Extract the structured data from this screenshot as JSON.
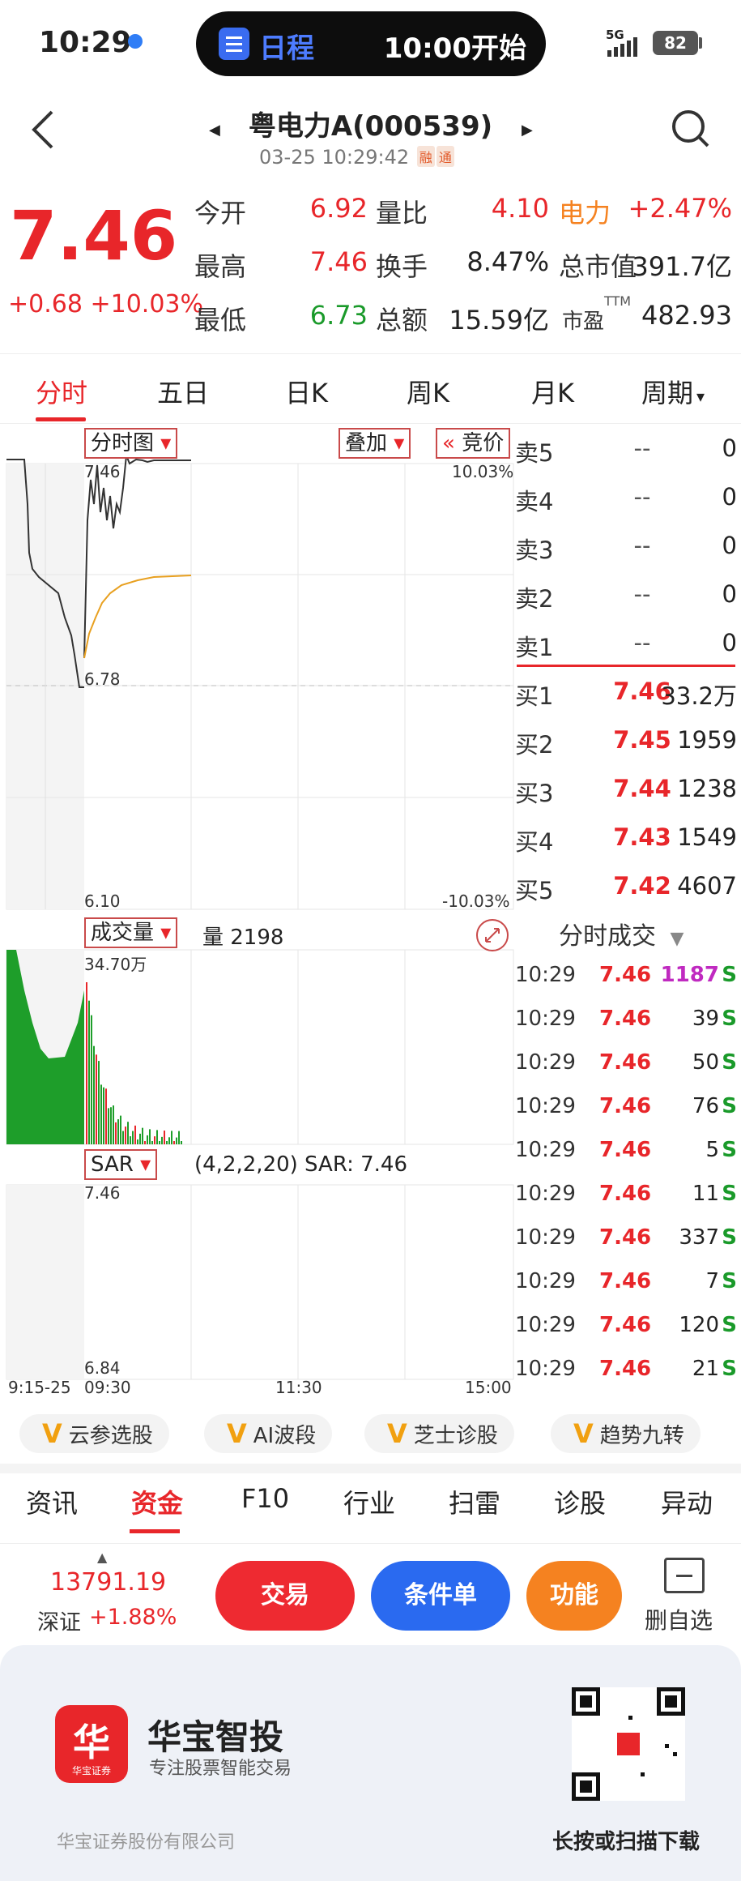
{
  "status_bar": {
    "time": "10:29",
    "schedule_label": "日程",
    "schedule_time": "10:00开始",
    "network": "5G",
    "battery": "82"
  },
  "header": {
    "title": "粤电力A(000539)",
    "datetime": "03-25 10:29:42",
    "tag_rong": "融",
    "tag_tong": "通"
  },
  "quote": {
    "price": "7.46",
    "change": "+0.68  +10.03%",
    "rows": [
      {
        "l1": "今开",
        "v1": "6.92",
        "c1": "red",
        "l2": "量比",
        "v2": "4.10",
        "c2": "red",
        "l3": "电力",
        "v3": "+2.47%",
        "c3": "red"
      },
      {
        "l1": "最高",
        "v1": "7.46",
        "c1": "red",
        "l2": "换手",
        "v2": "8.47%",
        "c2": "dark",
        "l3": "总市值",
        "v3": "391.7亿",
        "c3": "dark"
      },
      {
        "l1": "最低",
        "v1": "6.73",
        "c1": "green",
        "l2": "总额",
        "v2": "15.59亿",
        "c2": "dark",
        "l3": "市盈",
        "v3": "482.93",
        "c3": "dark"
      }
    ],
    "ttm": "TTM"
  },
  "tabs": [
    "分时",
    "五日",
    "日K",
    "周K",
    "月K",
    "周期"
  ],
  "chart": {
    "btn_timechart": "分时图",
    "btn_overlay": "叠加",
    "btn_auction": "竞价",
    "y_max": "7.46",
    "y_mid": "6.78",
    "y_min": "6.10",
    "pct_max": "10.03%",
    "pct_min": "-10.03%",
    "btn_volume": "成交量",
    "volume_label": "量 2198",
    "volume_max": "34.70万",
    "btn_sar": "SAR",
    "sar_label": "(4,2,2,20) SAR: 7.46",
    "sar_max": "7.46",
    "sar_min": "6.84",
    "x_labels": [
      "9:15-25",
      "09:30",
      "11:30",
      "15:00"
    ]
  },
  "order_book": {
    "sells": [
      {
        "label": "卖5",
        "price": "--",
        "vol": "0"
      },
      {
        "label": "卖4",
        "price": "--",
        "vol": "0"
      },
      {
        "label": "卖3",
        "price": "--",
        "vol": "0"
      },
      {
        "label": "卖2",
        "price": "--",
        "vol": "0"
      },
      {
        "label": "卖1",
        "price": "--",
        "vol": "0"
      }
    ],
    "buys": [
      {
        "label": "买1",
        "price": "7.46",
        "vol": "33.2万"
      },
      {
        "label": "买2",
        "price": "7.45",
        "vol": "1959"
      },
      {
        "label": "买3",
        "price": "7.44",
        "vol": "1238"
      },
      {
        "label": "买4",
        "price": "7.43",
        "vol": "1549"
      },
      {
        "label": "买5",
        "price": "7.42",
        "vol": "4607"
      }
    ]
  },
  "ticks": {
    "title": "分时成交",
    "rows": [
      {
        "time": "10:29",
        "price": "7.46",
        "vol": "1187",
        "side": "S",
        "big": true
      },
      {
        "time": "10:29",
        "price": "7.46",
        "vol": "39",
        "side": "S"
      },
      {
        "time": "10:29",
        "price": "7.46",
        "vol": "50",
        "side": "S"
      },
      {
        "time": "10:29",
        "price": "7.46",
        "vol": "76",
        "side": "S"
      },
      {
        "time": "10:29",
        "price": "7.46",
        "vol": "5",
        "side": "S"
      },
      {
        "time": "10:29",
        "price": "7.46",
        "vol": "11",
        "side": "S"
      },
      {
        "time": "10:29",
        "price": "7.46",
        "vol": "337",
        "side": "S"
      },
      {
        "time": "10:29",
        "price": "7.46",
        "vol": "7",
        "side": "S"
      },
      {
        "time": "10:29",
        "price": "7.46",
        "vol": "120",
        "side": "S"
      },
      {
        "time": "10:29",
        "price": "7.46",
        "vol": "21",
        "side": "S"
      }
    ]
  },
  "chips": [
    "云参选股",
    "AI波段",
    "芝士诊股",
    "趋势九转"
  ],
  "bottom_tabs": [
    "资讯",
    "资金",
    "F10",
    "行业",
    "扫雷",
    "诊股",
    "异动"
  ],
  "index": {
    "value": "13791.19",
    "name": "深证",
    "change": "+1.88%"
  },
  "actions": {
    "trade": "交易",
    "condition": "条件单",
    "function": "功能",
    "remove": "删自选"
  },
  "promo": {
    "logo_glyph": "华",
    "logo_sub": "华宝证券",
    "brand": "华宝智投",
    "tagline": "专注股票智能交易",
    "company": "华宝证券股份有限公司",
    "qr_hint": "长按或扫描下载"
  },
  "colors": {
    "up": "#e8262a",
    "down": "#1a9a2a",
    "avg_line": "#e8a020",
    "accent_blue": "#3a6cf0",
    "orange": "#f58220"
  }
}
